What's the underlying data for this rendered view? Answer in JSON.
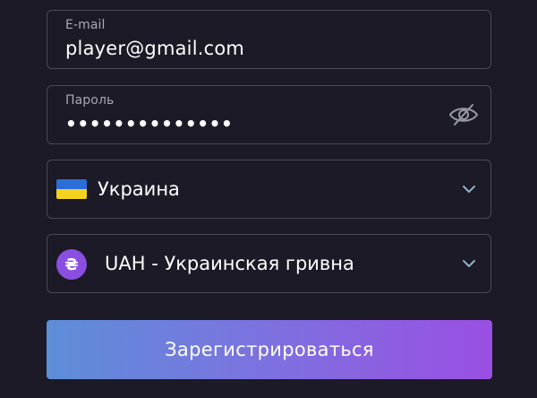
{
  "email": {
    "label": "E-mail",
    "value": "player@gmail.com"
  },
  "password": {
    "label": "Пароль",
    "masked_value": "••••••••••••••",
    "toggle_icon": "eye-off-icon"
  },
  "country": {
    "flag_icon": "ukraine-flag-icon",
    "value": "Украина",
    "chevron_icon": "chevron-down-icon"
  },
  "currency": {
    "symbol": "₴",
    "value": "UAH - Украинская гривна",
    "chevron_icon": "chevron-down-icon"
  },
  "submit": {
    "label": "Зарегистрироваться"
  },
  "colors": {
    "background": "#1b1a26",
    "border": "#4a4958",
    "coin": "#8a4fe0",
    "gradient_start": "#5d8ed8",
    "gradient_end": "#9a4fe2",
    "flag_blue": "#2b6ed8",
    "flag_yellow": "#f4d21f"
  }
}
